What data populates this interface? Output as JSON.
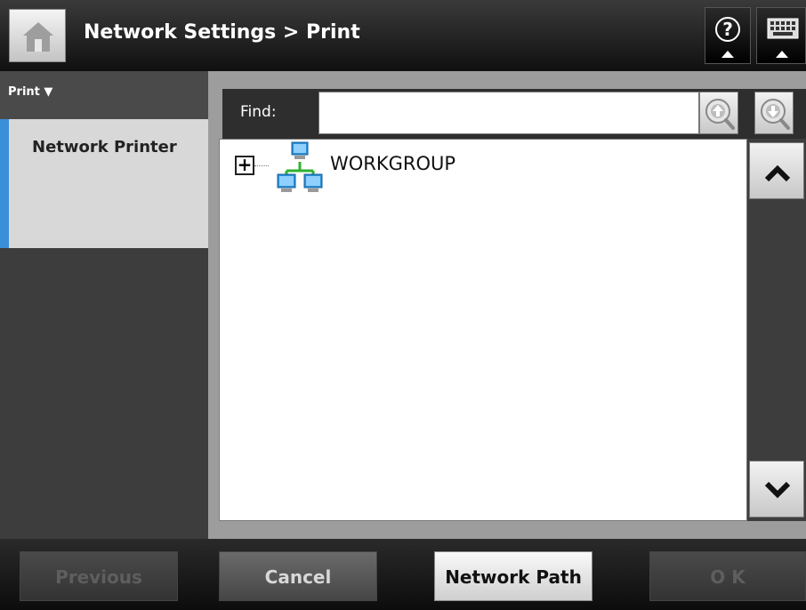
{
  "header": {
    "title": "Network Settings > Print",
    "home_icon": "home-icon",
    "help_icon": "help-icon",
    "keyboard_icon": "keyboard-icon"
  },
  "sidebar": {
    "section_label": "Print ▼",
    "items": [
      {
        "label": "Network Printer",
        "selected": true
      }
    ]
  },
  "find": {
    "label": "Find:",
    "value": "",
    "search_up_icon": "search-up-icon",
    "search_down_icon": "search-down-icon"
  },
  "tree": {
    "nodes": [
      {
        "expander": "+",
        "icon": "network-group-icon",
        "label": "WORKGROUP"
      }
    ]
  },
  "scroll": {
    "up_icon": "chevron-up-icon",
    "down_icon": "chevron-down-icon"
  },
  "footer": {
    "previous_label": "Previous",
    "cancel_label": "Cancel",
    "network_path_label": "Network Path",
    "ok_label": "O K"
  },
  "colors": {
    "accent": "#3a8fd9",
    "header_bg": "#101010",
    "network_icon_blue": "#2a8fd8",
    "network_icon_green": "#2fb02f"
  }
}
